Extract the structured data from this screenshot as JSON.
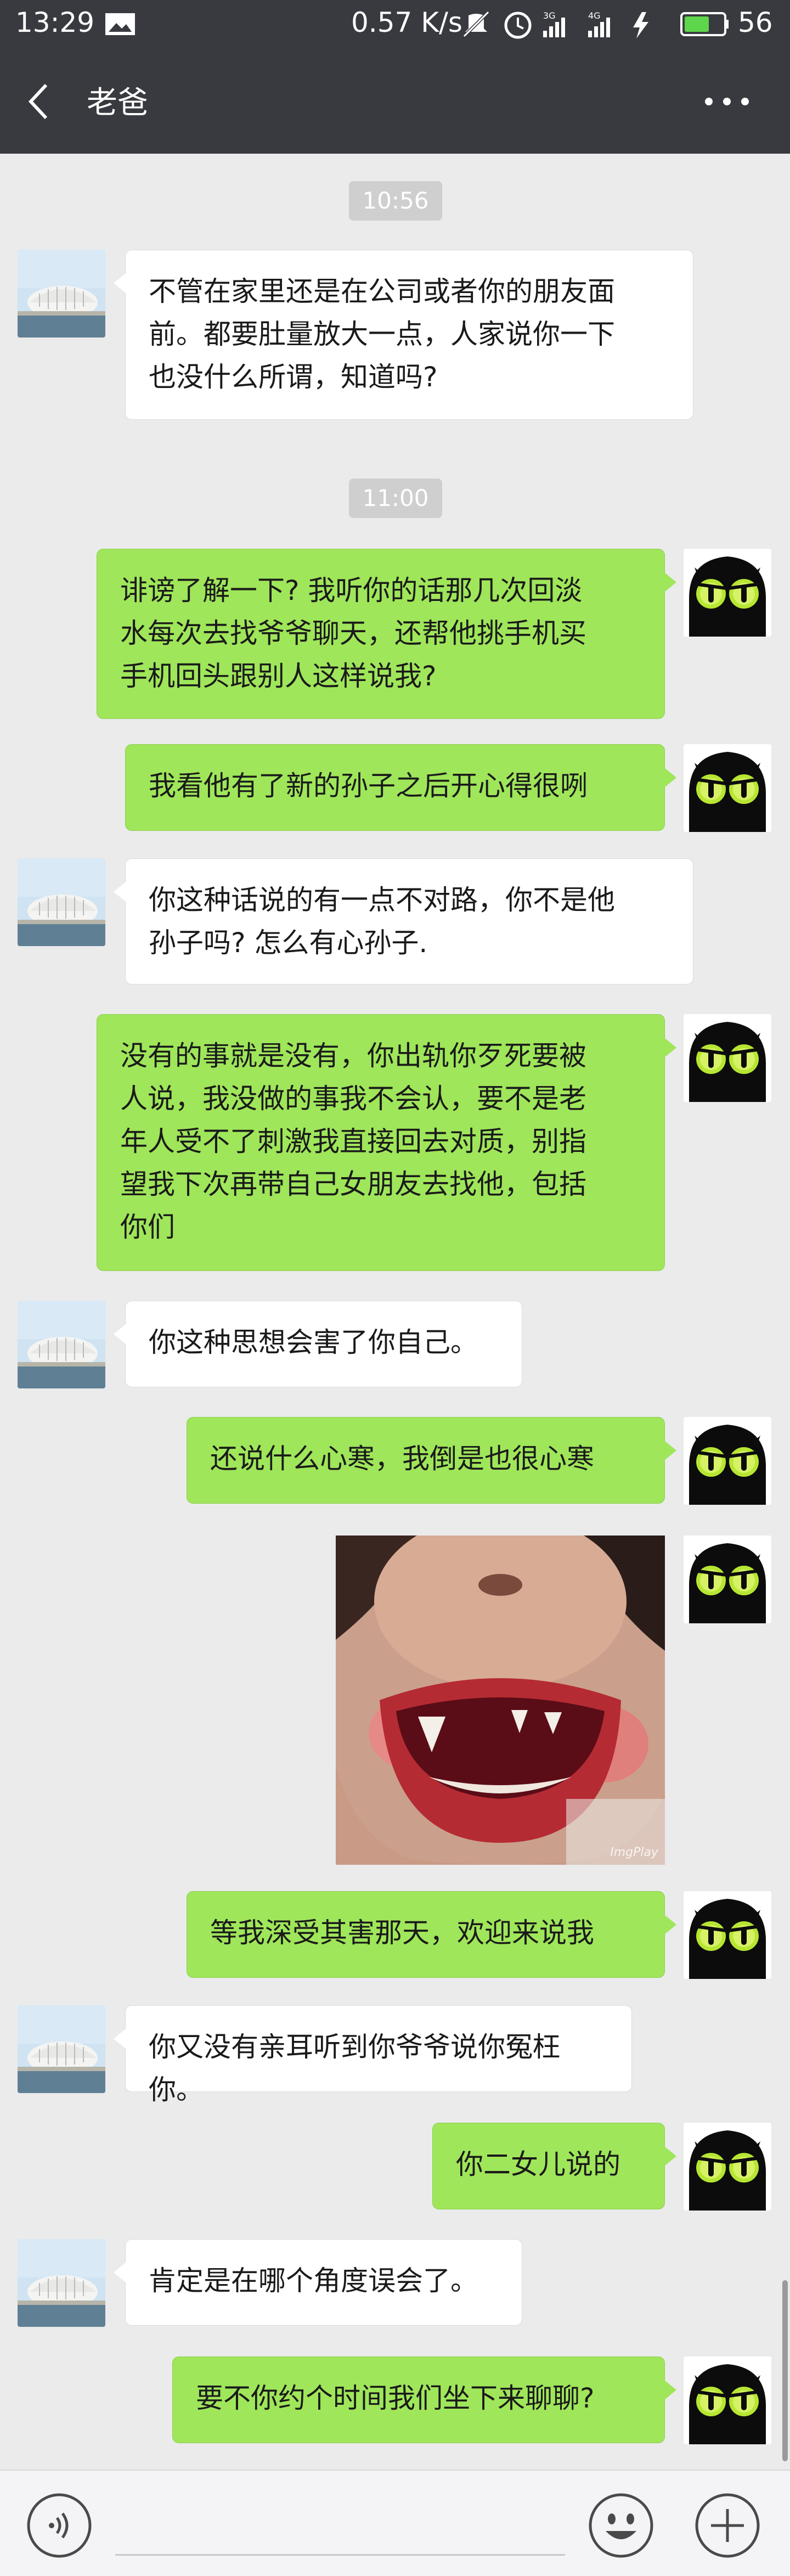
{
  "status_bar": {
    "time": "13:29",
    "network_speed": "0.57 K/s",
    "battery_level": "56",
    "icons": [
      "gallery-icon",
      "mute-icon",
      "alarm-icon",
      "signal-3g-icon",
      "signal-4g-icon",
      "charging-icon",
      "battery-icon"
    ]
  },
  "header": {
    "title": "老爸",
    "back_icon": "chevron-left-icon",
    "more_icon": "more-dots-icon"
  },
  "messages": {
    "ts1": "10:56",
    "m1": "不管在家里还是在公司或者你的朋友面\n前。都要肚量放大一点，人家说你一下\n也没什么所谓，知道吗?",
    "ts2": "11:00",
    "m2": "诽谤了解一下? 我听你的话那几次回淡\n水每次去找爷爷聊天，还帮他挑手机买\n手机回头跟别人这样说我?",
    "m3": "我看他有了新的孙子之后开心得很咧",
    "m4": "你这种话说的有一点不对路，你不是他\n孙子吗? 怎么有心孙子.",
    "m5": "没有的事就是没有，你出轨你歹死要被\n人说，我没做的事我不会认，要不是老\n年人受不了刺激我直接回去对质，别指\n望我下次再带自己女朋友去找他，包括\n你们",
    "m6": "你这种思想会害了你自己。",
    "m7": "还说什么心寒，我倒是也很心寒",
    "m8_watermark": "ImgPlay",
    "m9": "等我深受其害那天，欢迎来说我",
    "m10": "你又没有亲耳听到你爷爷说你冤枉你。",
    "m11": "你二女儿说的",
    "m12": "肯定是在哪个角度误会了。",
    "m13": "要不你约个时间我们坐下来聊聊?"
  },
  "input_bar": {
    "voice_icon": "voice-icon",
    "emoji_icon": "emoji-icon",
    "plus_icon": "plus-icon"
  },
  "colors": {
    "header_bg": "#393a3f",
    "chat_bg": "#ebebeb",
    "outgoing_bubble": "#9fe65a",
    "incoming_bubble": "#ffffff",
    "timestamp_bg": "#cfcfcf"
  }
}
